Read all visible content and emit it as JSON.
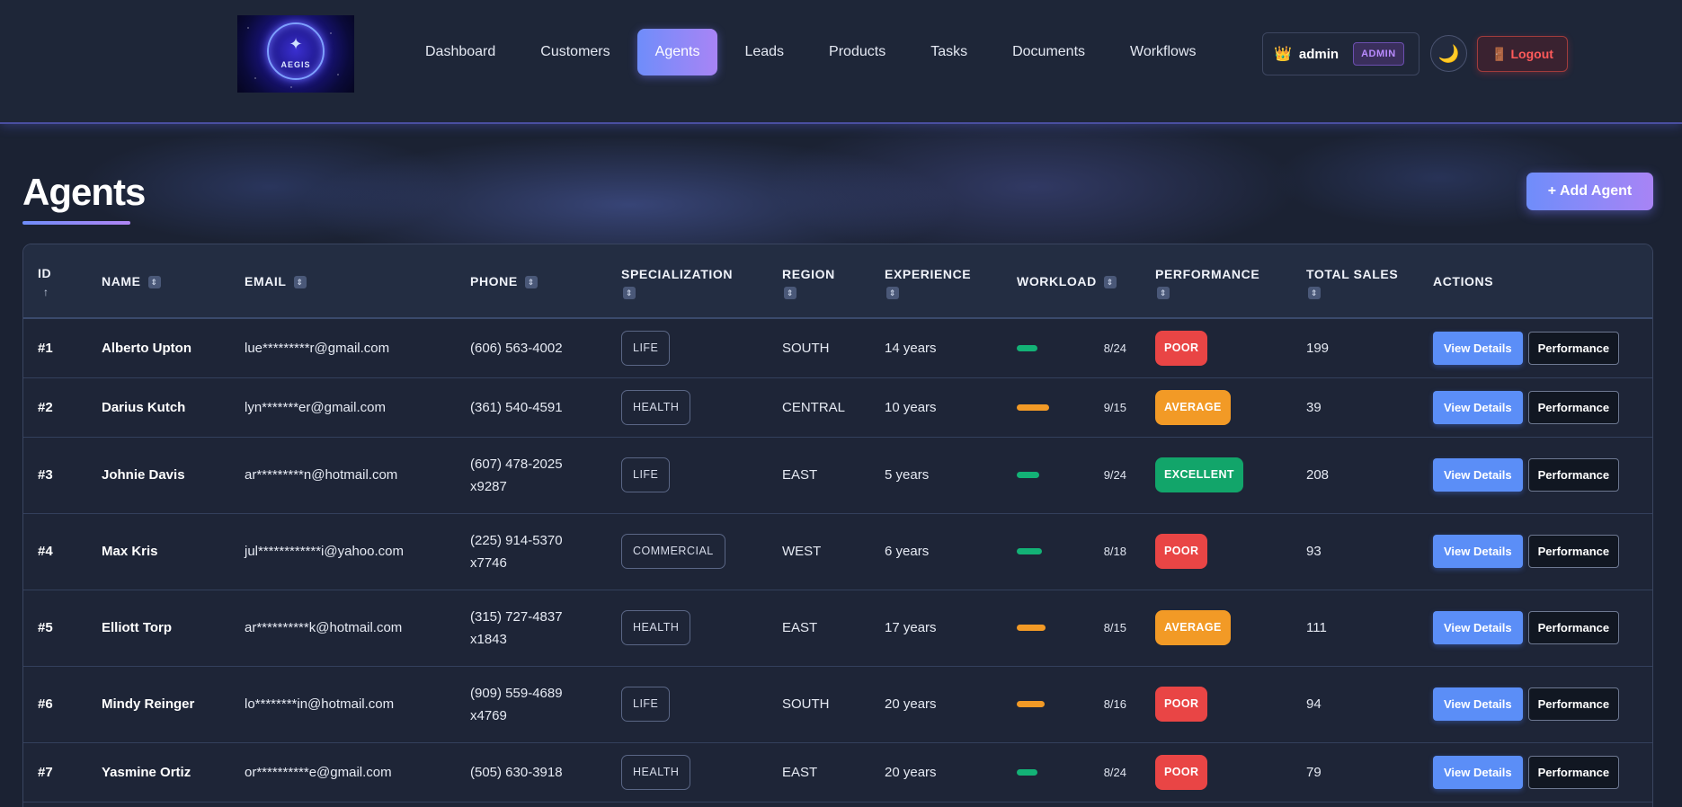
{
  "app": {
    "logo_text": "AEGIS",
    "nav": [
      "Dashboard",
      "Customers",
      "Agents",
      "Leads",
      "Products",
      "Tasks",
      "Documents",
      "Workflows"
    ],
    "active_nav": "Agents",
    "user": {
      "name": "admin",
      "role": "ADMIN",
      "crown_icon": "👑"
    },
    "theme_icon": "🌙",
    "logout": {
      "icon": "🚪",
      "label": "Logout"
    }
  },
  "page": {
    "title": "Agents",
    "add_button": "+ Add Agent"
  },
  "table": {
    "columns": [
      "ID",
      "NAME",
      "EMAIL",
      "PHONE",
      "SPECIALIZATION",
      "REGION",
      "EXPERIENCE",
      "WORKLOAD",
      "PERFORMANCE",
      "TOTAL SALES",
      "ACTIONS"
    ],
    "actions": {
      "view": "View Details",
      "performance": "Performance"
    },
    "rows": [
      {
        "id": "#1",
        "name": "Alberto Upton",
        "email": "lue*********r@gmail.com",
        "phone": [
          "(606) 563-4002"
        ],
        "spec": "LIFE",
        "region": "SOUTH",
        "experience": "14 years",
        "workload": "8/24",
        "workload_level": 0.33,
        "perf": "POOR",
        "sales": "199"
      },
      {
        "id": "#2",
        "name": "Darius Kutch",
        "email": "lyn*******er@gmail.com",
        "phone": [
          "(361) 540-4591"
        ],
        "spec": "HEALTH",
        "region": "CENTRAL",
        "experience": "10 years",
        "workload": "9/15",
        "workload_level": 0.6,
        "perf": "AVERAGE",
        "sales": "39"
      },
      {
        "id": "#3",
        "name": "Johnie Davis",
        "email": "ar*********n@hotmail.com",
        "phone": [
          "(607) 478-2025",
          "x9287"
        ],
        "spec": "LIFE",
        "region": "EAST",
        "experience": "5 years",
        "workload": "9/24",
        "workload_level": 0.375,
        "perf": "EXCELLENT",
        "sales": "208"
      },
      {
        "id": "#4",
        "name": "Max Kris",
        "email": "jul************i@yahoo.com",
        "phone": [
          "(225) 914-5370",
          "x7746"
        ],
        "spec": "COMMERCIAL",
        "region": "WEST",
        "experience": "6 years",
        "workload": "8/18",
        "workload_level": 0.44,
        "perf": "POOR",
        "sales": "93"
      },
      {
        "id": "#5",
        "name": "Elliott Torp",
        "email": "ar**********k@hotmail.com",
        "phone": [
          "(315) 727-4837",
          "x1843"
        ],
        "spec": "HEALTH",
        "region": "EAST",
        "experience": "17 years",
        "workload": "8/15",
        "workload_level": 0.53,
        "perf": "AVERAGE",
        "sales": "111"
      },
      {
        "id": "#6",
        "name": "Mindy Reinger",
        "email": "lo********in@hotmail.com",
        "phone": [
          "(909) 559-4689",
          "x4769"
        ],
        "spec": "LIFE",
        "region": "SOUTH",
        "experience": "20 years",
        "workload": "8/16",
        "workload_level": 0.5,
        "perf": "POOR",
        "sales": "94"
      },
      {
        "id": "#7",
        "name": "Yasmine Ortiz",
        "email": "or**********e@gmail.com",
        "phone": [
          "(505) 630-3918"
        ],
        "spec": "HEALTH",
        "region": "EAST",
        "experience": "20 years",
        "workload": "8/24",
        "workload_level": 0.33,
        "perf": "POOR",
        "sales": "79"
      }
    ]
  },
  "colors": {
    "accent_start": "#6f8dfa",
    "accent_end": "#a884f5",
    "poor": "#e94545",
    "average": "#f29a26",
    "excellent": "#12a56a",
    "workload_low": "#13b276",
    "workload_mid": "#f29a26"
  }
}
